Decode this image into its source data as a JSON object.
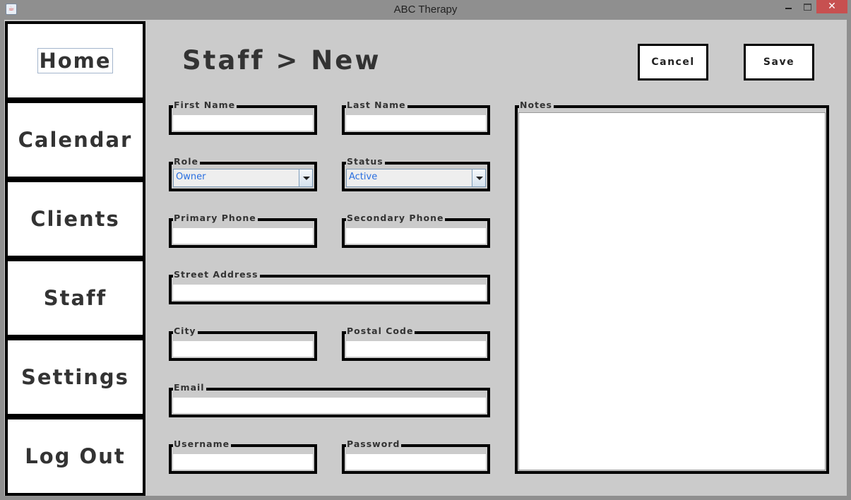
{
  "window": {
    "title": "ABC Therapy",
    "close_glyph": "✕"
  },
  "sidebar": {
    "items": [
      {
        "label": "Home"
      },
      {
        "label": "Calendar"
      },
      {
        "label": "Clients"
      },
      {
        "label": "Staff"
      },
      {
        "label": "Settings"
      },
      {
        "label": "Log Out"
      }
    ]
  },
  "header": {
    "title": "Staff > New",
    "cancel_label": "Cancel",
    "save_label": "Save"
  },
  "form": {
    "first_name": {
      "label": "First Name",
      "value": ""
    },
    "last_name": {
      "label": "Last Name",
      "value": ""
    },
    "role": {
      "label": "Role",
      "value": "Owner"
    },
    "status": {
      "label": "Status",
      "value": "Active"
    },
    "primary_phone": {
      "label": "Primary Phone",
      "value": ""
    },
    "secondary_phone": {
      "label": "Secondary Phone",
      "value": ""
    },
    "street_address": {
      "label": "Street Address",
      "value": ""
    },
    "city": {
      "label": "City",
      "value": ""
    },
    "postal_code": {
      "label": "Postal Code",
      "value": ""
    },
    "email": {
      "label": "Email",
      "value": ""
    },
    "username": {
      "label": "Username",
      "value": ""
    },
    "password": {
      "label": "Password",
      "value": ""
    },
    "notes": {
      "label": "Notes",
      "value": ""
    }
  }
}
